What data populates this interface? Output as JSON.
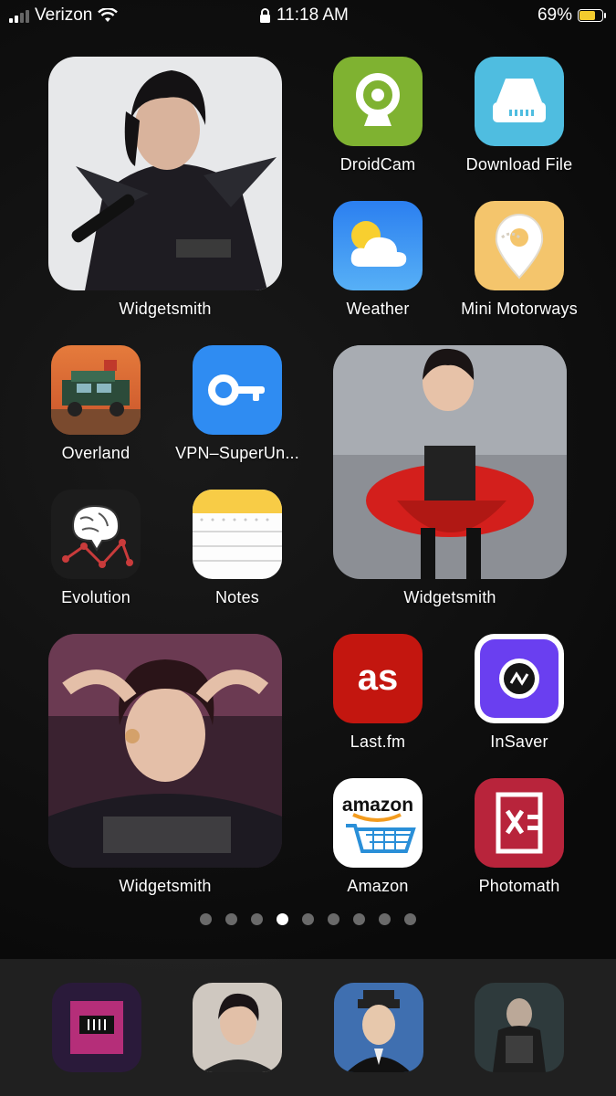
{
  "status_bar": {
    "carrier": "Verizon",
    "time": "11:18 AM",
    "battery": "69%",
    "battery_level": 0.69
  },
  "widgets": [
    {
      "label": "Widgetsmith"
    },
    {
      "label": "Widgetsmith"
    },
    {
      "label": "Widgetsmith"
    }
  ],
  "apps": {
    "droidcam": "DroidCam",
    "download_file": "Download File",
    "weather": "Weather",
    "mini_motorways": "Mini Motorways",
    "overland": "Overland",
    "vpn": "VPN–SuperUn...",
    "evolution": "Evolution",
    "notes": "Notes",
    "lastfm": "Last.fm",
    "insaver": "InSaver",
    "amazon": "Amazon",
    "photomath": "Photomath"
  },
  "icon_text": {
    "amazon_logo": "amazon",
    "lastfm_logo": "as"
  },
  "page_dots": {
    "count": 9,
    "active_index": 3
  },
  "dock": [
    "dock-app-1",
    "dock-app-2",
    "dock-app-3",
    "dock-app-4"
  ],
  "colors": {
    "droidcam": "#7fb231",
    "download": "#4fbde0",
    "vpn": "#2f8cf2",
    "lastfm": "#c3160f",
    "photomath": "#b8243b",
    "insaver": "#6a3ff0"
  }
}
